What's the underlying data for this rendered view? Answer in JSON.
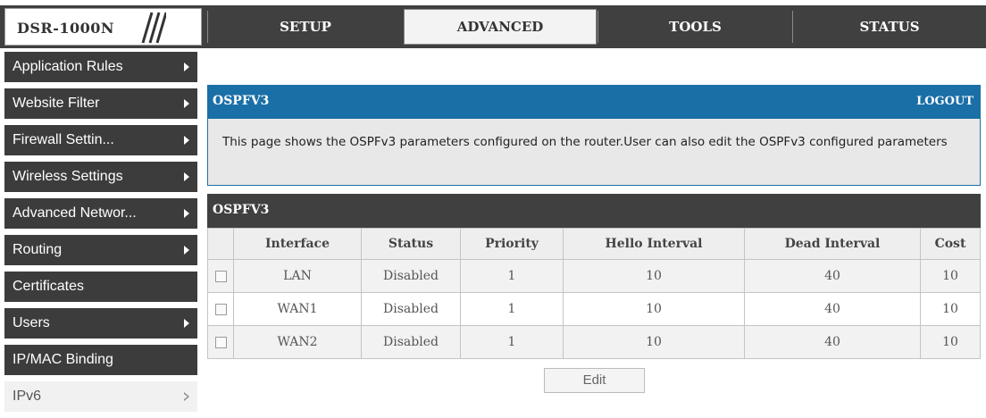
{
  "brand": {
    "model": "DSR-1000N"
  },
  "nav": {
    "tabs": [
      {
        "label": "SETUP"
      },
      {
        "label": "ADVANCED"
      },
      {
        "label": "TOOLS"
      },
      {
        "label": "STATUS"
      }
    ],
    "active": "ADVANCED"
  },
  "sidebar": {
    "items": [
      {
        "label": "Application Rules"
      },
      {
        "label": "Website Filter"
      },
      {
        "label": "Firewall Settin..."
      },
      {
        "label": "Wireless Settings"
      },
      {
        "label": "Advanced Networ..."
      },
      {
        "label": "Routing"
      },
      {
        "label": "Certificates"
      },
      {
        "label": "Users"
      },
      {
        "label": "IP/MAC Binding"
      },
      {
        "label": "IPv6"
      }
    ],
    "selected": "IPv6"
  },
  "info_panel": {
    "title": "OSPFV3",
    "logout_label": "LOGOUT",
    "description": "This page shows the OSPFv3 parameters configured on the router.User can also edit the OSPFv3 configured parameters"
  },
  "table": {
    "title": "OSPFV3",
    "columns": [
      "",
      "Interface",
      "Status",
      "Priority",
      "Hello Interval",
      "Dead Interval",
      "Cost"
    ],
    "rows": [
      {
        "interface": "LAN",
        "status": "Disabled",
        "priority": "1",
        "hello": "10",
        "dead": "40",
        "cost": "10",
        "checked": false
      },
      {
        "interface": "WAN1",
        "status": "Disabled",
        "priority": "1",
        "hello": "10",
        "dead": "40",
        "cost": "10",
        "checked": false
      },
      {
        "interface": "WAN2",
        "status": "Disabled",
        "priority": "1",
        "hello": "10",
        "dead": "40",
        "cost": "10",
        "checked": false
      }
    ]
  },
  "actions": {
    "edit_label": "Edit"
  },
  "colors": {
    "header_dark": "#404040",
    "panel_blue": "#1a6fa6",
    "sidebar_dark": "#3c3c3c"
  },
  "icons": {
    "sidebar_arrow": "right-triangle-icon",
    "sidebar_arrow_selected": "right-triangle-outline-icon",
    "row_select": "checkbox-icon"
  }
}
